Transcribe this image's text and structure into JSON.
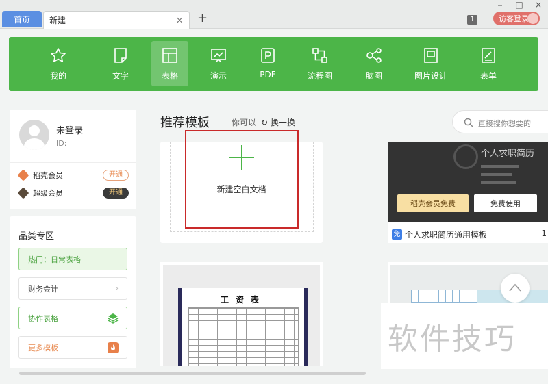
{
  "tabs": {
    "home": "首页",
    "current": "新建",
    "close": "×",
    "add": "+"
  },
  "window_controls": [
    "⎯",
    "□",
    "×"
  ],
  "header": {
    "notification_count": "1",
    "login_label": "访客登录"
  },
  "categories": [
    {
      "label": "我的",
      "icon": "star-icon"
    },
    {
      "label": "文字",
      "icon": "document-icon"
    },
    {
      "label": "表格",
      "icon": "table-icon",
      "active": true
    },
    {
      "label": "演示",
      "icon": "presentation-icon"
    },
    {
      "label": "PDF",
      "icon": "pdf-icon"
    },
    {
      "label": "流程图",
      "icon": "flowchart-icon"
    },
    {
      "label": "脑图",
      "icon": "mindmap-icon"
    },
    {
      "label": "图片设计",
      "icon": "image-design-icon"
    },
    {
      "label": "表单",
      "icon": "form-icon"
    }
  ],
  "user": {
    "name": "未登录",
    "id_label": "ID:",
    "memberships": [
      {
        "label": "稻壳会员",
        "action": "开通",
        "color": "#e8804a"
      },
      {
        "label": "超级会员",
        "action": "开通",
        "color": "#5a4a3a"
      }
    ]
  },
  "zone": {
    "title": "品类专区",
    "items": [
      {
        "label": "热门：日常表格"
      },
      {
        "label": "财务会计",
        "trail": "›"
      },
      {
        "label": "协作表格"
      },
      {
        "label": "更多模板"
      }
    ]
  },
  "main": {
    "title": "推荐模板",
    "you_can": "你可以",
    "swap": "换一换",
    "search_placeholder": "直接搜你想要的"
  },
  "cards": {
    "blank": {
      "label": "新建空白文档"
    },
    "resume": {
      "image_title": "个人求职简历",
      "btn_member": "稻壳会员免费",
      "btn_free": "免费使用",
      "free_tag": "免",
      "caption": "个人求职简历通用模板",
      "extra": "1"
    },
    "salary": {
      "sheet_title": "工资表"
    }
  },
  "watermark": "软件技巧",
  "colors": {
    "accent_green": "#4cb548",
    "tab_blue": "#5b8fe2",
    "highlight_red": "#c92a2a"
  }
}
